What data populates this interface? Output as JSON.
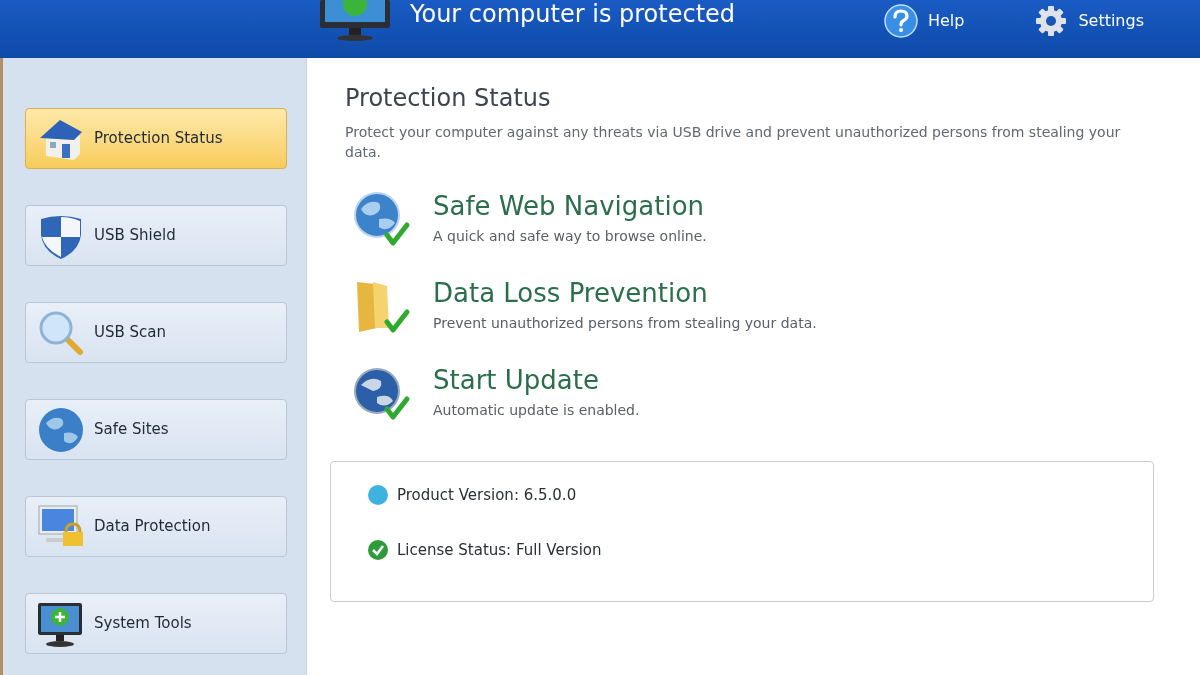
{
  "header": {
    "title": "Your computer is protected",
    "buttons": [
      "Help",
      "Settings"
    ]
  },
  "sidebar": {
    "items": [
      {
        "label": "Protection Status",
        "selected": true
      },
      {
        "label": "USB Shield",
        "selected": false
      },
      {
        "label": "USB Scan",
        "selected": false
      },
      {
        "label": "Safe Sites",
        "selected": false
      },
      {
        "label": "Data Protection",
        "selected": false
      },
      {
        "label": "System Tools",
        "selected": false
      }
    ]
  },
  "main": {
    "title": "Protection Status",
    "description": "Protect your computer against any threats via USB drive and prevent unauthorized persons from stealing your data.",
    "features": [
      {
        "title": "Safe Web Navigation",
        "subtitle": "A quick and safe way to browse online."
      },
      {
        "title": "Data Loss Prevention",
        "subtitle": "Prevent unauthorized persons from stealing your data."
      },
      {
        "title": "Start Update",
        "subtitle": "Automatic update is enabled."
      }
    ],
    "info": [
      "Product Version: 6.5.0.0",
      "License Status: Full Version"
    ]
  }
}
